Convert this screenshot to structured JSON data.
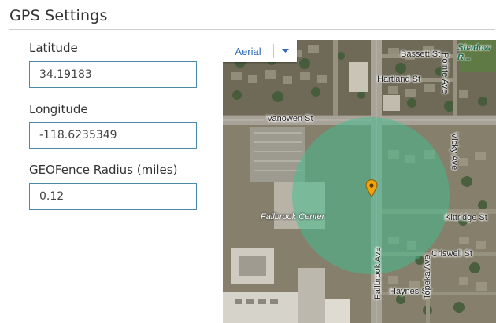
{
  "section": {
    "title": "GPS Settings"
  },
  "fields": {
    "latitude": {
      "label": "Latitude",
      "value": "34.19183"
    },
    "longitude": {
      "label": "Longitude",
      "value": "-118.6235349"
    },
    "radius": {
      "label": "GEOFence Radius (miles)",
      "value": "0.12"
    }
  },
  "map": {
    "type_control": {
      "selected": "Aerial",
      "icon": "chevron-down-icon"
    },
    "streets": {
      "vanowen": "Vanowen St",
      "bassett": "Bassett St",
      "hartland": "Hartland St",
      "kittridge": "Kittridge St",
      "criswell": "Criswell St",
      "haynes": "Haynes St",
      "pointe": "Pointe Ave",
      "vicky": "Vicky Ave",
      "fallbrook": "Fallbrook Ave",
      "topeka": "Topeka Ave"
    },
    "places": {
      "fallbrook_center": "Fallbrook Center",
      "park": "Shadow R..."
    },
    "geofence": {
      "fill": "#3fbf8f",
      "opacity": 0.5
    },
    "pin": {
      "color": "#f0a30a"
    }
  }
}
